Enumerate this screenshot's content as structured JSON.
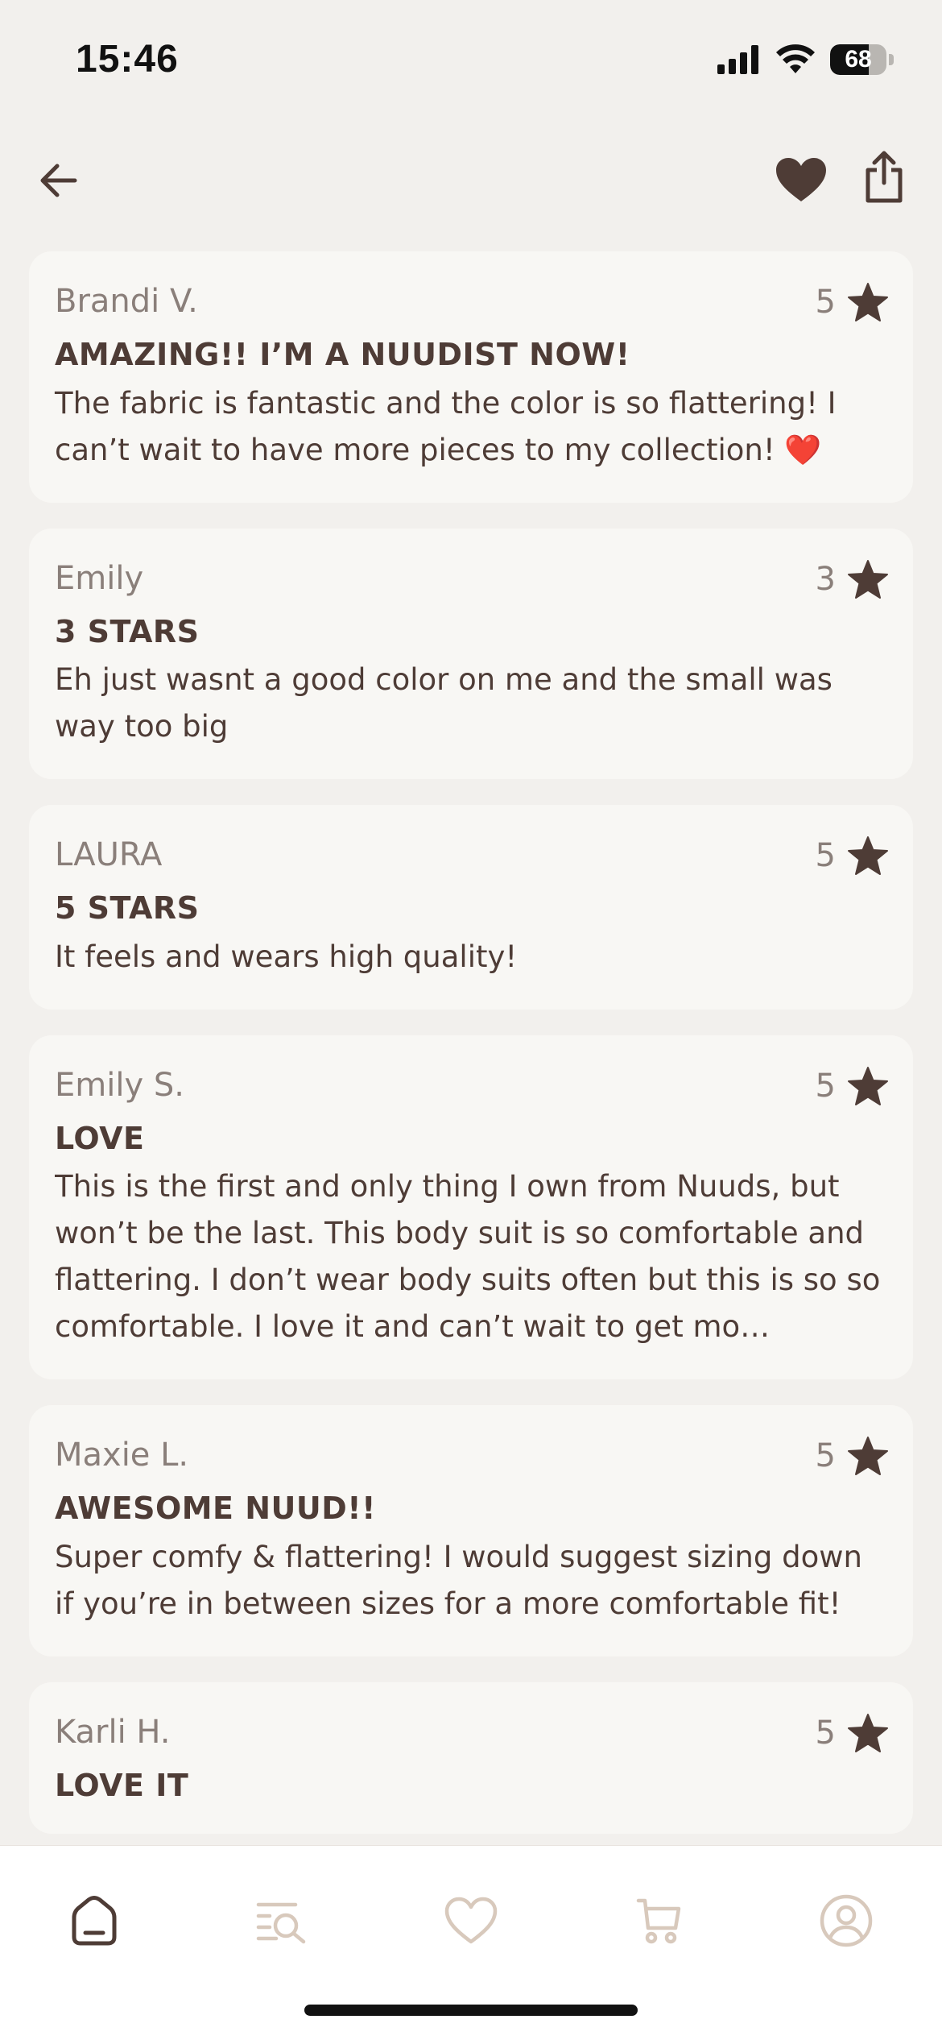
{
  "status": {
    "time": "15:46",
    "battery": "68",
    "battery_level": 0.68
  },
  "reviews": [
    {
      "author": "Brandi V.",
      "rating": "5",
      "title": "AMAZING!! I’M A NUUDIST NOW!",
      "body": "The fabric is fantastic and the color is so flattering! I can’t wait to have more pieces to my collection! ❤️"
    },
    {
      "author": "Emily",
      "rating": "3",
      "title": "3 STARS",
      "body": "Eh just wasnt a good color on me and the small was way too big"
    },
    {
      "author": "LAURA",
      "rating": "5",
      "title": "5 STARS",
      "body": "It feels and wears high quality!"
    },
    {
      "author": "Emily S.",
      "rating": "5",
      "title": "LOVE",
      "body": "This is the first and only thing I own from Nuuds, but won’t be the last. This body suit is so comfortable and flattering. I don’t wear body suits often but this is so so comfortable. I love it and can’t wait to get mo…"
    },
    {
      "author": "Maxie L.",
      "rating": "5",
      "title": "AWESOME NUUD!!",
      "body": "Super comfy & flattering! I would suggest sizing down if you’re in between sizes for a more comfortable fit!"
    },
    {
      "author": "Karli H.",
      "rating": "5",
      "title": "LOVE IT",
      "body": ""
    }
  ],
  "icons": {
    "back": "arrow-left-icon",
    "favorite": "heart-filled-icon",
    "share": "share-icon",
    "star": "star-icon",
    "tabs": [
      "home-icon",
      "search-list-icon",
      "heart-outline-icon",
      "cart-icon",
      "profile-icon"
    ]
  },
  "colors": {
    "background": "#f2f0ed",
    "card": "#f8f7f4",
    "text_dark": "#4e3c36",
    "text_muted": "#8a7f7a",
    "tab_inactive": "#d8c9bc",
    "tab_active": "#4e3c36"
  },
  "active_tab": "home"
}
